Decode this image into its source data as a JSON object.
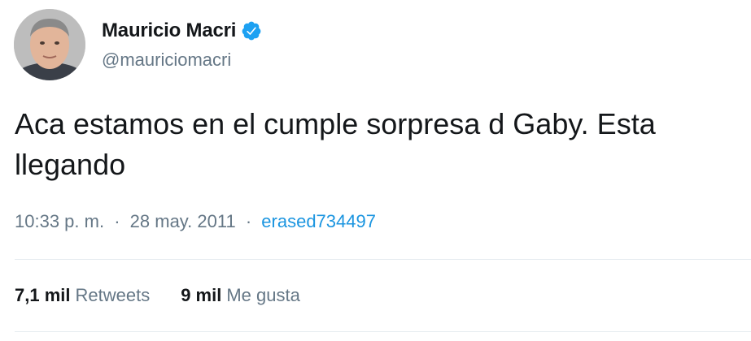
{
  "user": {
    "display_name": "Mauricio Macri",
    "handle": "@mauriciomacri",
    "verified": true
  },
  "tweet": {
    "text": "Aca estamos en el cumple sorpresa d Gaby. Esta llegando",
    "time": "10:33 p. m.",
    "separator": "·",
    "date": "28 may. 2011",
    "source": "erased734497"
  },
  "stats": {
    "retweets_count": "7,1 mil",
    "retweets_label": "Retweets",
    "likes_count": "9 mil",
    "likes_label": "Me gusta"
  },
  "colors": {
    "primary_text": "#14171a",
    "secondary_text": "#657786",
    "link": "#1b95e0",
    "verified_badge": "#1da1f2",
    "divider": "#e6ecf0"
  },
  "icons": {
    "verified": "verified-badge-icon",
    "avatar": "profile-photo"
  }
}
